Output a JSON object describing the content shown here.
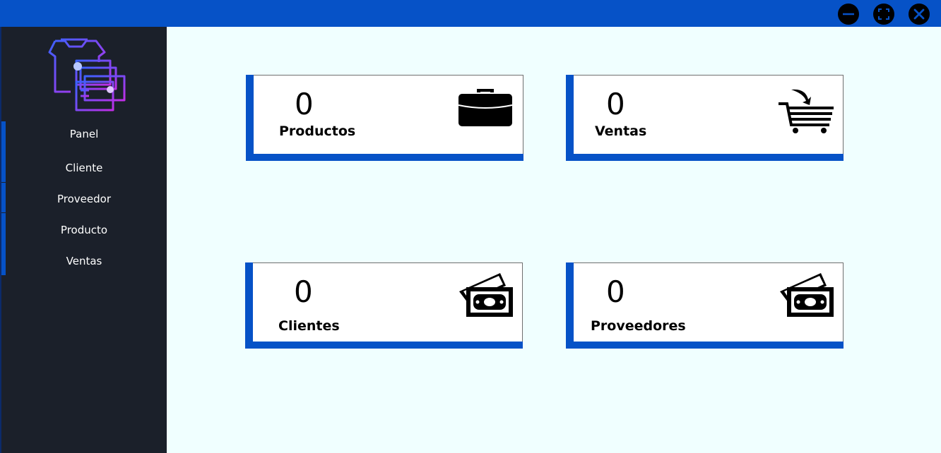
{
  "window": {
    "accent_color": "#0652c7",
    "sidebar_color": "#1b202a",
    "content_color": "#f0ffff",
    "controls": [
      {
        "name": "minimize-icon"
      },
      {
        "name": "maximize-icon"
      },
      {
        "name": "close-icon"
      }
    ]
  },
  "sidebar": {
    "logo": "clothing-store-logo",
    "items": [
      {
        "label": "Panel"
      },
      {
        "label": "Cliente"
      },
      {
        "label": "Proveedor"
      },
      {
        "label": "Producto"
      },
      {
        "label": "Ventas"
      }
    ]
  },
  "dashboard": {
    "cards": [
      {
        "value": "0",
        "label": "Productos",
        "icon": "briefcase-icon"
      },
      {
        "value": "0",
        "label": "Ventas",
        "icon": "shopping-cart-icon"
      },
      {
        "value": "0",
        "label": "Clientes",
        "icon": "money-icon"
      },
      {
        "value": "0",
        "label": "Proveedores",
        "icon": "money-icon"
      }
    ]
  }
}
